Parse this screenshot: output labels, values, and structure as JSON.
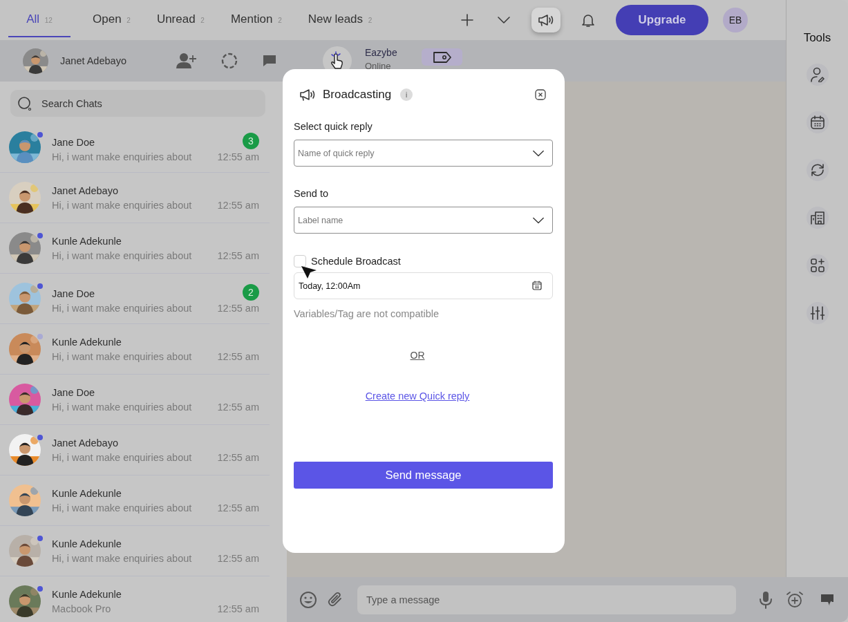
{
  "tabs": [
    {
      "label": "All",
      "count": "12",
      "selected": true
    },
    {
      "label": "Open",
      "count": "2",
      "selected": false
    },
    {
      "label": "Unread",
      "count": "2",
      "selected": false
    },
    {
      "label": "Mention",
      "count": "2",
      "selected": false
    },
    {
      "label": "New leads",
      "count": "2",
      "selected": false
    }
  ],
  "toolbar": {
    "upgrade": "Upgrade",
    "avatar": "EB"
  },
  "account": {
    "name": "Janet Adebayo"
  },
  "search": {
    "placeholder": "Search Chats"
  },
  "chats": [
    {
      "name": "Jane Doe",
      "preview": "Hi, i want make enquiries about",
      "time": "12:55 am",
      "unread": "3",
      "color": "#4e55d4"
    },
    {
      "name": "Janet Adebayo",
      "preview": "Hi, i want make enquiries about",
      "time": "12:55 am"
    },
    {
      "name": "Kunle Adekunle",
      "preview": "Hi, i want make enquiries about",
      "time": "12:55 am",
      "color": "#4e55d4"
    },
    {
      "name": "Jane Doe",
      "preview": "Hi, i want make enquiries about",
      "time": "12:55 am",
      "unread": "2",
      "color": "#4e55d4"
    },
    {
      "name": "Kunle Adekunle",
      "preview": "Hi, i want make enquiries about",
      "time": "12:55 am",
      "color": "#a9aad4"
    },
    {
      "name": "Jane Doe",
      "preview": "Hi, i want make enquiries about",
      "time": "12:55 am"
    },
    {
      "name": "Janet Adebayo",
      "preview": "Hi, i want make enquiries about",
      "time": "12:55 am",
      "color": "#4e55d4"
    },
    {
      "name": "Kunle Adekunle",
      "preview": "Hi, i want make enquiries about",
      "time": "12:55 am"
    },
    {
      "name": "Kunle Adekunle",
      "preview": "Hi, i want make enquiries about",
      "time": "12:55 am",
      "color": "#4e55d4"
    },
    {
      "name": "Kunle Adekunle",
      "preview": "Macbook Pro",
      "time": "12:55 am",
      "color": "#4e55d4"
    }
  ],
  "conversation": {
    "name": "Eazybe",
    "status": "Online"
  },
  "tools": {
    "title": "Tools"
  },
  "composer": {
    "placeholder": "Type a message"
  },
  "modal": {
    "title": "Broadcasting",
    "info": "i",
    "quick_reply": {
      "label": "Select quick reply",
      "placeholder": "Name of quick reply"
    },
    "send_to": {
      "label": "Send to",
      "placeholder": "Label name"
    },
    "schedule": {
      "label": "Schedule Broadcast",
      "checked": false
    },
    "date": {
      "value": "Today, 12:00Am"
    },
    "note": "Variables/Tag are not compatible",
    "or": "OR",
    "create_link": "Create new Quick reply",
    "send": "Send message"
  }
}
